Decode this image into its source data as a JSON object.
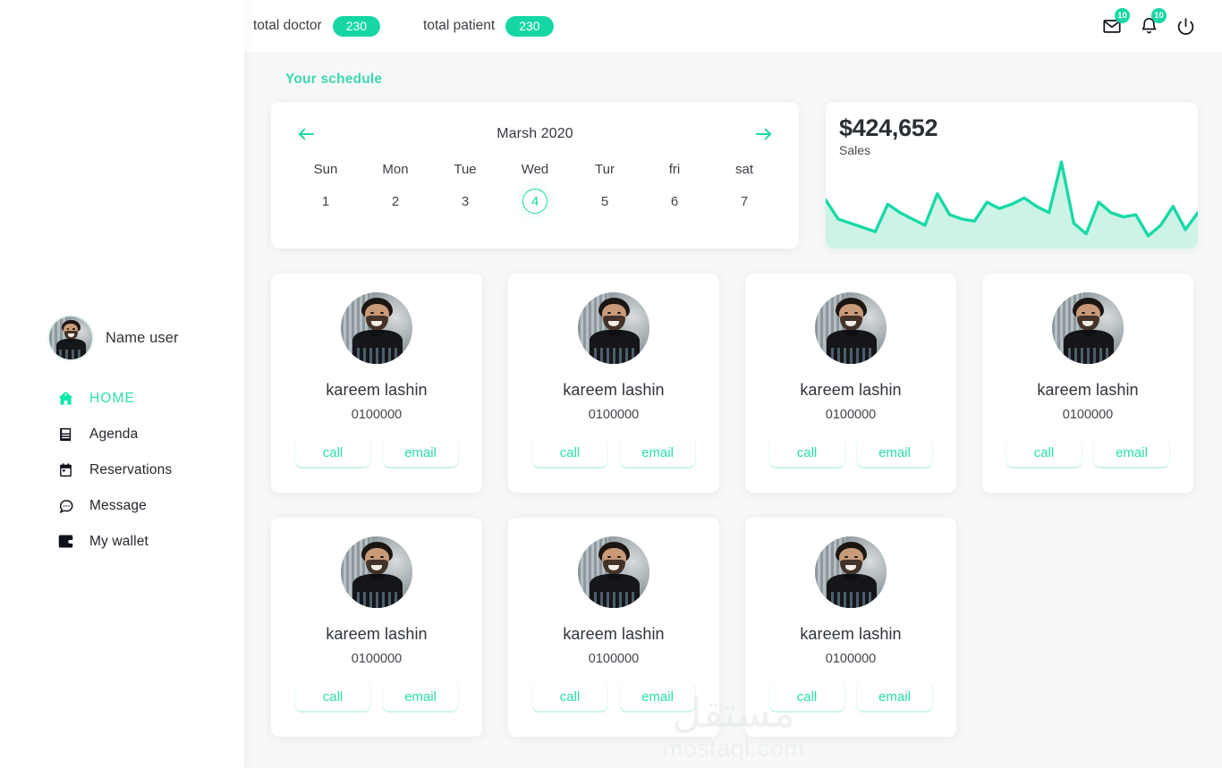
{
  "topbar": {
    "stats": [
      {
        "label": "total doctor",
        "count": "230"
      },
      {
        "label": "total patient",
        "count": "230"
      }
    ],
    "icons": [
      {
        "name": "mail-icon",
        "badge": "10"
      },
      {
        "name": "bell-icon",
        "badge": "10"
      },
      {
        "name": "power-icon",
        "badge": ""
      }
    ]
  },
  "sidebar": {
    "user": {
      "name": "Name user",
      "avatar": "user-portrait"
    },
    "items": [
      {
        "label": "HOME",
        "icon": "home-icon",
        "active": true
      },
      {
        "label": "Agenda",
        "icon": "book-icon",
        "active": false
      },
      {
        "label": "Reservations",
        "icon": "calendar-icon",
        "active": false
      },
      {
        "label": "Message",
        "icon": "chat-bubble-icon",
        "active": false
      },
      {
        "label": "My wallet",
        "icon": "wallet-icon",
        "active": false
      }
    ]
  },
  "main": {
    "section_title": "Your schedule",
    "schedule": {
      "month": "Marsh 2020",
      "prev_icon": "arrow-left-icon",
      "next_icon": "arrow-right-icon",
      "weekdays": [
        "Sun",
        "Mon",
        "Tue",
        "Wed",
        "Tur",
        "fri",
        "sat"
      ],
      "days": [
        {
          "num": "1",
          "selected": false
        },
        {
          "num": "2",
          "selected": false
        },
        {
          "num": "3",
          "selected": false
        },
        {
          "num": "4",
          "selected": true
        },
        {
          "num": "5",
          "selected": false
        },
        {
          "num": "6",
          "selected": false
        },
        {
          "num": "7",
          "selected": false
        }
      ]
    },
    "sales": {
      "value": "$424,652",
      "label": "Sales"
    },
    "people": [
      {
        "name": "kareem lashin",
        "phone": "0100000",
        "call_label": "call",
        "email_label": "email"
      },
      {
        "name": "kareem lashin",
        "phone": "0100000",
        "call_label": "call",
        "email_label": "email"
      },
      {
        "name": "kareem lashin",
        "phone": "0100000",
        "call_label": "call",
        "email_label": "email"
      },
      {
        "name": "kareem lashin",
        "phone": "0100000",
        "call_label": "call",
        "email_label": "email"
      },
      {
        "name": "kareem lashin",
        "phone": "0100000",
        "call_label": "call",
        "email_label": "email"
      },
      {
        "name": "kareem lashin",
        "phone": "0100000",
        "call_label": "call",
        "email_label": "email"
      },
      {
        "name": "kareem lashin",
        "phone": "0100000",
        "call_label": "call",
        "email_label": "email"
      }
    ]
  },
  "watermark": {
    "arabic": "مستقل",
    "latin": "mostaql.com"
  },
  "colors": {
    "accent": "#16d7a4",
    "accent_bright": "#2ae0ad",
    "accent_line": "#18d9a6",
    "spark_fill": "#cdf3e7",
    "page_bg": "#f7f8f8",
    "card_bg": "#ffffff",
    "text": "#2f343a",
    "watermark": "#e4e8e8"
  },
  "chart_data": {
    "type": "area",
    "title": "Sales",
    "value_label": "$424,652",
    "xlabel": "",
    "ylabel": "",
    "grid": false,
    "legend": false,
    "line_color": "#18d9a6",
    "fill_color": "#cdf3e7",
    "x": [
      0,
      1,
      2,
      3,
      4,
      5,
      6,
      7,
      8,
      9,
      10,
      11,
      12,
      13,
      14,
      15,
      16,
      17,
      18,
      19,
      20,
      21,
      22,
      23,
      24,
      25,
      26,
      27,
      28,
      29,
      30
    ],
    "values": [
      46,
      28,
      24,
      20,
      16,
      42,
      34,
      28,
      22,
      52,
      32,
      28,
      26,
      44,
      38,
      42,
      48,
      40,
      34,
      82,
      24,
      14,
      44,
      34,
      30,
      32,
      12,
      22,
      40,
      18,
      34
    ],
    "ylim": [
      0,
      100
    ]
  }
}
